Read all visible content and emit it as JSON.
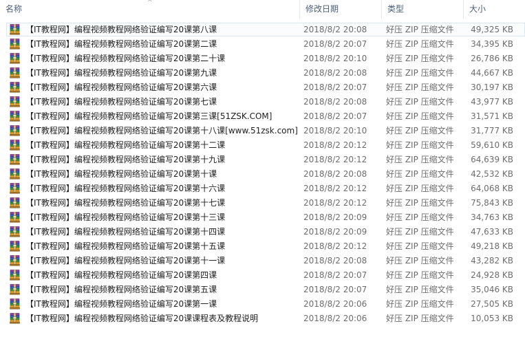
{
  "columns": {
    "name": "名称",
    "date": "修改日期",
    "type": "类型",
    "size": "大小"
  },
  "icon": "winrar-archive-icon",
  "colors": {
    "header_text": "#4c607a",
    "selection_border": "#d9e6f5"
  },
  "files": [
    {
      "name": "【IT教程网】编程视频教程网络验证编写20课第八课",
      "date": "2018/8/2 20:08",
      "type": "好压 ZIP 压缩文件",
      "size": "49,325 KB"
    },
    {
      "name": "【IT教程网】编程视频教程网络验证编写20课第二课",
      "date": "2018/8/2 20:07",
      "type": "好压 ZIP 压缩文件",
      "size": "34,395 KB"
    },
    {
      "name": "【IT教程网】编程视频教程网络验证编写20课第二十课",
      "date": "2018/8/2 20:10",
      "type": "好压 ZIP 压缩文件",
      "size": "26,786 KB"
    },
    {
      "name": "【IT教程网】编程视频教程网络验证编写20课第九课",
      "date": "2018/8/2 20:08",
      "type": "好压 ZIP 压缩文件",
      "size": "44,667 KB"
    },
    {
      "name": "【IT教程网】编程视频教程网络验证编写20课第六课",
      "date": "2018/8/2 20:07",
      "type": "好压 ZIP 压缩文件",
      "size": "30,197 KB"
    },
    {
      "name": "【IT教程网】编程视频教程网络验证编写20课第七课",
      "date": "2018/8/2 20:08",
      "type": "好压 ZIP 压缩文件",
      "size": "43,977 KB"
    },
    {
      "name": "【IT教程网】编程视频教程网络验证编写20课第三课[51ZSK.COM]",
      "date": "2018/8/2 20:07",
      "type": "好压 ZIP 压缩文件",
      "size": "31,571 KB"
    },
    {
      "name": "【IT教程网】编程视频教程网络验证编写20课第十八课[www.51zsk.com]",
      "date": "2018/8/2 20:10",
      "type": "好压 ZIP 压缩文件",
      "size": "31,777 KB"
    },
    {
      "name": "【IT教程网】编程视频教程网络验证编写20课第十二课",
      "date": "2018/8/2 20:12",
      "type": "好压 ZIP 压缩文件",
      "size": "59,610 KB"
    },
    {
      "name": "【IT教程网】编程视频教程网络验证编写20课第十九课",
      "date": "2018/8/2 20:12",
      "type": "好压 ZIP 压缩文件",
      "size": "64,639 KB"
    },
    {
      "name": "【IT教程网】编程视频教程网络验证编写20课第十课",
      "date": "2018/8/2 20:08",
      "type": "好压 ZIP 压缩文件",
      "size": "42,532 KB"
    },
    {
      "name": "【IT教程网】编程视频教程网络验证编写20课第十六课",
      "date": "2018/8/2 20:12",
      "type": "好压 ZIP 压缩文件",
      "size": "64,068 KB"
    },
    {
      "name": "【IT教程网】编程视频教程网络验证编写20课第十七课",
      "date": "2018/8/2 20:12",
      "type": "好压 ZIP 压缩文件",
      "size": "75,843 KB"
    },
    {
      "name": "【IT教程网】编程视频教程网络验证编写20课第十三课",
      "date": "2018/8/2 20:09",
      "type": "好压 ZIP 压缩文件",
      "size": "34,763 KB"
    },
    {
      "name": "【IT教程网】编程视频教程网络验证编写20课第十四课",
      "date": "2018/8/2 20:09",
      "type": "好压 ZIP 压缩文件",
      "size": "47,633 KB"
    },
    {
      "name": "【IT教程网】编程视频教程网络验证编写20课第十五课",
      "date": "2018/8/2 20:12",
      "type": "好压 ZIP 压缩文件",
      "size": "49,218 KB"
    },
    {
      "name": "【IT教程网】编程视频教程网络验证编写20课第十一课",
      "date": "2018/8/2 20:08",
      "type": "好压 ZIP 压缩文件",
      "size": "43,282 KB"
    },
    {
      "name": "【IT教程网】编程视频教程网络验证编写20课第四课",
      "date": "2018/8/2 20:07",
      "type": "好压 ZIP 压缩文件",
      "size": "24,928 KB"
    },
    {
      "name": "【IT教程网】编程视频教程网络验证编写20课第五课",
      "date": "2018/8/2 20:07",
      "type": "好压 ZIP 压缩文件",
      "size": "35,046 KB"
    },
    {
      "name": "【IT教程网】编程视频教程网络验证编写20课第一课",
      "date": "2018/8/2 20:06",
      "type": "好压 ZIP 压缩文件",
      "size": "27,505 KB"
    },
    {
      "name": "【IT教程网】编程视频教程网络验证编写20课课程表及教程说明",
      "date": "2018/8/2 20:06",
      "type": "好压 ZIP 压缩文件",
      "size": "10,053 KB"
    }
  ]
}
